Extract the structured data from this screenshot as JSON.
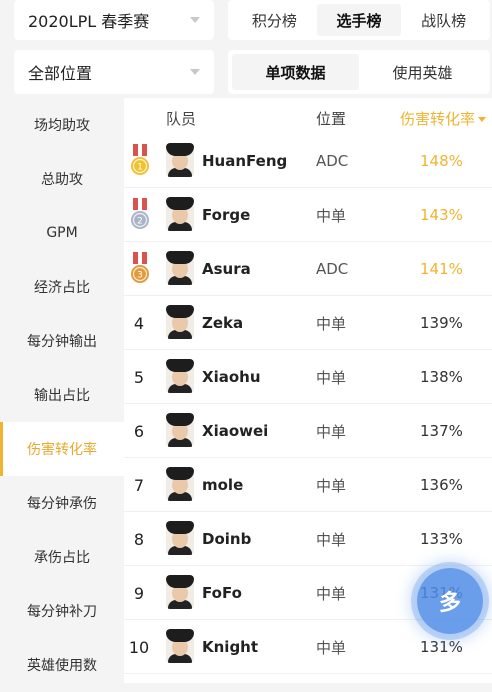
{
  "filters": {
    "season": "2020LPL 春季赛",
    "position": "全部位置"
  },
  "top_tabs": [
    "积分榜",
    "选手榜",
    "战队榜"
  ],
  "sub_tabs": [
    "单项数据",
    "使用英雄"
  ],
  "sidebar": {
    "items": [
      "场均助攻",
      "总助攻",
      "GPM",
      "经济占比",
      "每分钟输出",
      "输出占比",
      "伤害转化率",
      "每分钟承伤",
      "承伤占比",
      "每分钟补刀",
      "英雄使用数"
    ],
    "active_index": 6
  },
  "table": {
    "headers": {
      "player": "队员",
      "position": "位置",
      "stat": "伤害转化率"
    },
    "rows": [
      {
        "rank": "1",
        "medal": "gold",
        "name": "HuanFeng",
        "position": "ADC",
        "value": "148%"
      },
      {
        "rank": "2",
        "medal": "silver",
        "name": "Forge",
        "position": "中单",
        "value": "143%"
      },
      {
        "rank": "3",
        "medal": "bronze",
        "name": "Asura",
        "position": "ADC",
        "value": "141%"
      },
      {
        "rank": "4",
        "name": "Zeka",
        "position": "中单",
        "value": "139%"
      },
      {
        "rank": "5",
        "name": "Xiaohu",
        "position": "中单",
        "value": "138%"
      },
      {
        "rank": "6",
        "name": "Xiaowei",
        "position": "中单",
        "value": "137%"
      },
      {
        "rank": "7",
        "name": "mole",
        "position": "中单",
        "value": "136%"
      },
      {
        "rank": "8",
        "name": "Doinb",
        "position": "中单",
        "value": "133%"
      },
      {
        "rank": "9",
        "name": "FoFo",
        "position": "中单",
        "value": "131%"
      },
      {
        "rank": "10",
        "name": "Knight",
        "position": "中单",
        "value": "131%"
      }
    ]
  },
  "fab": {
    "label": "多"
  },
  "colors": {
    "accent": "#f0b431",
    "gold": "#f2c12e",
    "silver": "#aab4c8",
    "bronze": "#e39a3b",
    "fab": "#5a8fe0"
  }
}
